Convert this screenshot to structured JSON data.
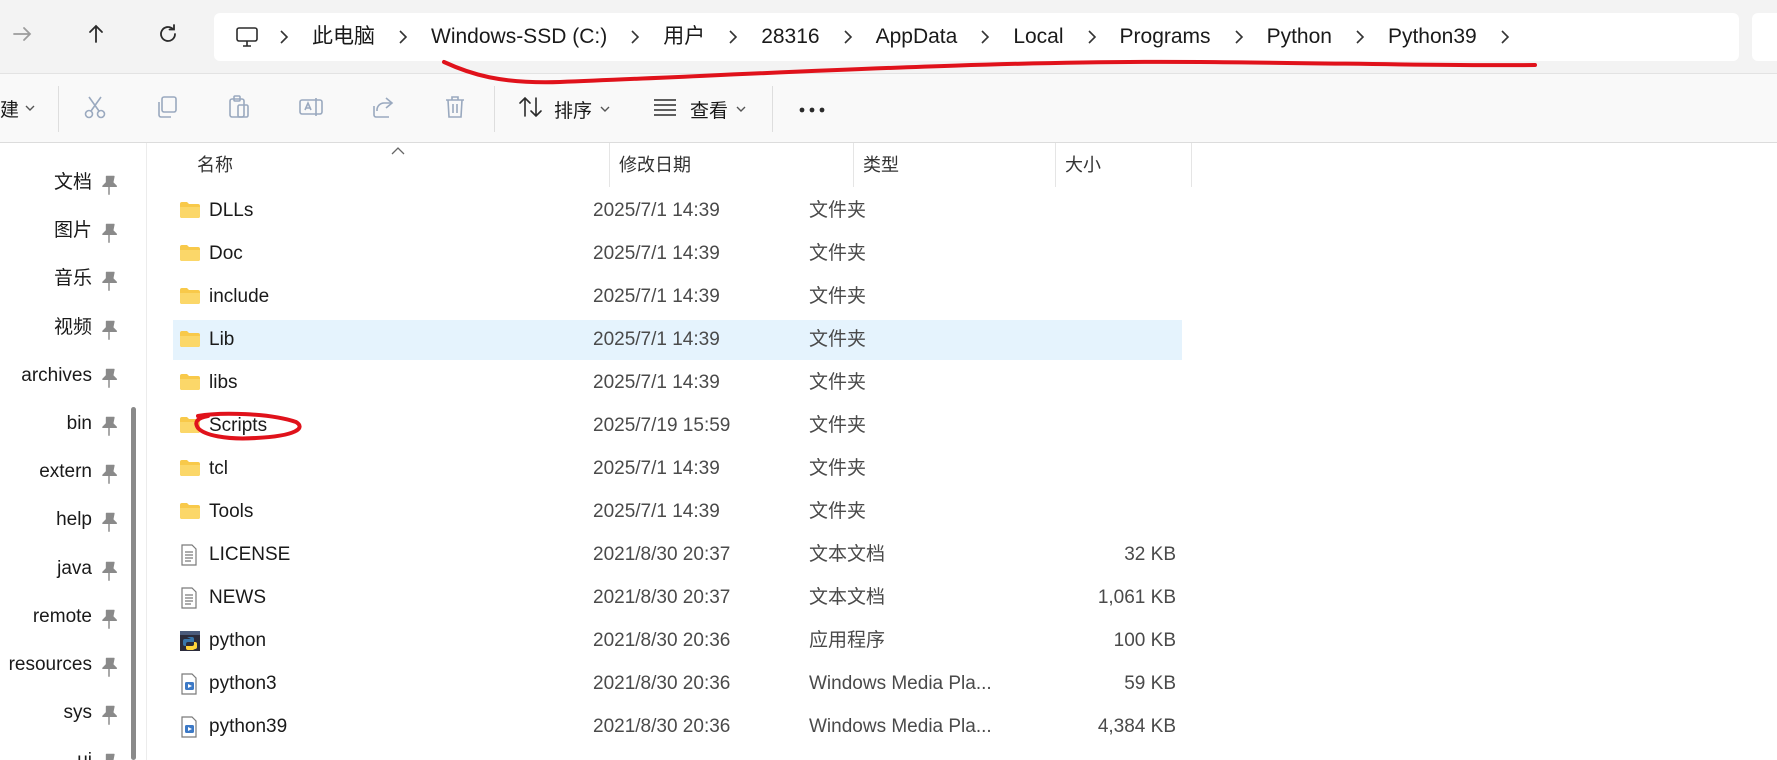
{
  "address": {
    "crumbs": [
      "此电脑",
      "Windows-SSD (C:)",
      "用户",
      "28316",
      "AppData",
      "Local",
      "Programs",
      "Python",
      "Python39"
    ]
  },
  "toolbar": {
    "new_label": "建",
    "sort_label": "排序",
    "view_label": "查看",
    "more_label": "···"
  },
  "sidebar": {
    "items": [
      {
        "label": "文档"
      },
      {
        "label": "图片"
      },
      {
        "label": "音乐"
      },
      {
        "label": "视频"
      },
      {
        "label": "archives"
      },
      {
        "label": "bin"
      },
      {
        "label": "extern"
      },
      {
        "label": "help"
      },
      {
        "label": "java"
      },
      {
        "label": "remote"
      },
      {
        "label": "resources"
      },
      {
        "label": "sys"
      },
      {
        "label": "ui"
      }
    ]
  },
  "columns": {
    "name": "名称",
    "date": "修改日期",
    "type": "类型",
    "size": "大小"
  },
  "files": [
    {
      "name": "DLLs",
      "date": "2025/7/1 14:39",
      "type": "文件夹",
      "size": "",
      "icon": "folder-icon"
    },
    {
      "name": "Doc",
      "date": "2025/7/1 14:39",
      "type": "文件夹",
      "size": "",
      "icon": "folder-icon"
    },
    {
      "name": "include",
      "date": "2025/7/1 14:39",
      "type": "文件夹",
      "size": "",
      "icon": "folder-icon"
    },
    {
      "name": "Lib",
      "date": "2025/7/1 14:39",
      "type": "文件夹",
      "size": "",
      "icon": "folder-icon"
    },
    {
      "name": "libs",
      "date": "2025/7/1 14:39",
      "type": "文件夹",
      "size": "",
      "icon": "folder-icon"
    },
    {
      "name": "Scripts",
      "date": "2025/7/19 15:59",
      "type": "文件夹",
      "size": "",
      "icon": "folder-icon"
    },
    {
      "name": "tcl",
      "date": "2025/7/1 14:39",
      "type": "文件夹",
      "size": "",
      "icon": "folder-icon"
    },
    {
      "name": "Tools",
      "date": "2025/7/1 14:39",
      "type": "文件夹",
      "size": "",
      "icon": "folder-icon"
    },
    {
      "name": "LICENSE",
      "date": "2021/8/30 20:37",
      "type": "文本文档",
      "size": "32 KB",
      "icon": "text-file-icon"
    },
    {
      "name": "NEWS",
      "date": "2021/8/30 20:37",
      "type": "文本文档",
      "size": "1,061 KB",
      "icon": "text-file-icon"
    },
    {
      "name": "python",
      "date": "2021/8/30 20:36",
      "type": "应用程序",
      "size": "100 KB",
      "icon": "python-app-icon"
    },
    {
      "name": "python3",
      "date": "2021/8/30 20:36",
      "type": "Windows Media Pla...",
      "size": "59 KB",
      "icon": "media-file-icon"
    },
    {
      "name": "python39",
      "date": "2021/8/30 20:36",
      "type": "Windows Media Pla...",
      "size": "4,384 KB",
      "icon": "media-file-icon"
    }
  ],
  "colors": {
    "accent": "#0067c0",
    "selection": "#e5f3fd",
    "annotation": "#e0121b",
    "folder": "#f8c94a"
  }
}
